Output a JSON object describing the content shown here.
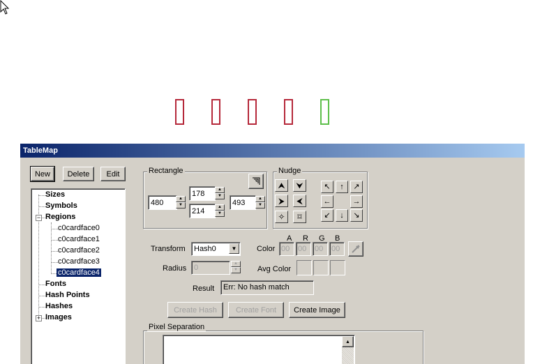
{
  "window": {
    "title": "TableMap"
  },
  "colors": {
    "region_red": "#b5283a",
    "region_green": "#5dbf4a",
    "selection": "#0a246a"
  },
  "toolbar": {
    "new_label": "New",
    "delete_label": "Delete",
    "edit_label": "Edit"
  },
  "tree": {
    "sizes": "Sizes",
    "symbols": "Symbols",
    "regions": "Regions",
    "region_children": [
      "c0cardface0",
      "c0cardface1",
      "c0cardface2",
      "c0cardface3",
      "c0cardface4"
    ],
    "fonts": "Fonts",
    "hash_points": "Hash Points",
    "hashes": "Hashes",
    "images": "Images",
    "expand_minus": "−",
    "expand_plus": "+"
  },
  "rectangle": {
    "label": "Rectangle",
    "left": "480",
    "top": "178",
    "bottom": "214",
    "right": "493"
  },
  "nudge": {
    "label": "Nudge"
  },
  "transform": {
    "label": "Transform",
    "value": "Hash0"
  },
  "color": {
    "label": "Color",
    "a_label": "A",
    "r_label": "R",
    "g_label": "G",
    "b_label": "B",
    "a": "00",
    "r": "00",
    "g": "00",
    "b": "00"
  },
  "radius": {
    "label": "Radius",
    "value": "0"
  },
  "avg_color": {
    "label": "Avg Color"
  },
  "result": {
    "label": "Result",
    "value": "Err: No hash match"
  },
  "actions": {
    "create_hash": "Create Hash",
    "create_font": "Create Font",
    "create_image": "Create Image"
  },
  "pixel_separation": {
    "label": "Pixel Separation"
  }
}
